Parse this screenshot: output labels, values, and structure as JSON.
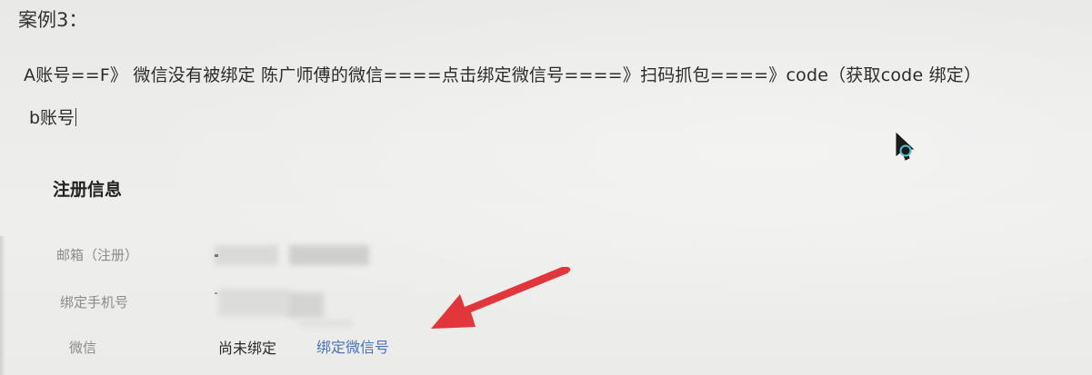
{
  "note": {
    "case_title": "案例3：",
    "flow_line": "A账号==F》 微信没有被绑定  陈广师傅的微信====点击绑定微信号====》扫码抓包====》code（获取code 绑定）",
    "account_b": "b账号"
  },
  "profile": {
    "section_title": "注册信息",
    "email_label": "邮箱（注册）",
    "phone_label": "绑定手机号",
    "wechat_label": "微信",
    "wechat_status": "尚未绑定",
    "bind_wechat_link": "绑定微信号"
  },
  "annotation": {
    "arrow_color": "#e0262b"
  }
}
